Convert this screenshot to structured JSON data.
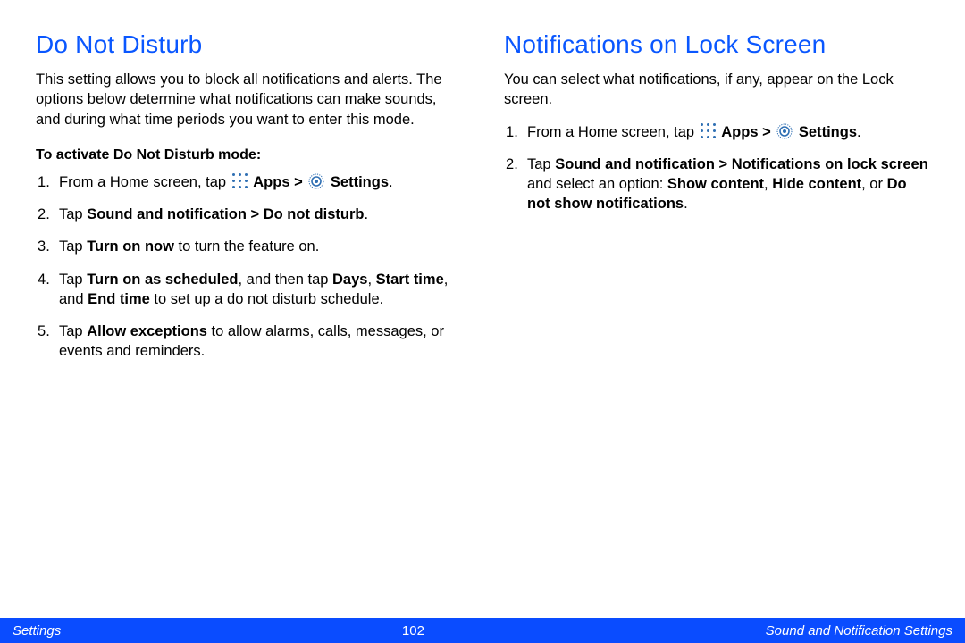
{
  "left": {
    "heading": "Do Not Disturb",
    "intro": "This setting allows you to block all notifications and alerts. The options below determine what notifications can make sounds, and during what time periods you want to enter this mode.",
    "subhead": "To activate Do Not Disturb mode:",
    "step1_pre": "From a Home screen, tap ",
    "apps_label": "Apps",
    "gt": ">",
    "settings_label": "Settings",
    "step2_pre": "Tap ",
    "step2_bold": "Sound and notification > Do not disturb",
    "step3_pre": "Tap ",
    "step3_bold": "Turn on now",
    "step3_post": " to turn the feature on.",
    "step4_pre": "Tap ",
    "step4_b1": "Turn on as scheduled",
    "step4_mid1": ", and then tap ",
    "step4_b2": "Days",
    "step4_mid2": ", ",
    "step4_b3": "Start time",
    "step4_mid3": ", and ",
    "step4_b4": "End time",
    "step4_post": " to set up a do not disturb schedule.",
    "step5_pre": "Tap ",
    "step5_bold": "Allow exceptions",
    "step5_post": " to allow alarms, calls, messages, or events and reminders."
  },
  "right": {
    "heading": "Notifications on Lock Screen",
    "intro": "You can select what notifications, if any, appear on the Lock screen.",
    "step1_pre": "From a Home screen, tap ",
    "apps_label": "Apps",
    "gt": ">",
    "settings_label": "Settings",
    "step2_pre": "Tap ",
    "step2_b1": "Sound and notification > Notifications on lock screen",
    "step2_mid1": " and select an option: ",
    "step2_b2": "Show content",
    "step2_mid2": ", ",
    "step2_b3": "Hide content",
    "step2_mid3": ", or ",
    "step2_b4": "Do not show notifications",
    "period": "."
  },
  "footer": {
    "left": "Settings",
    "page": "102",
    "right": "Sound and Notification Settings"
  }
}
